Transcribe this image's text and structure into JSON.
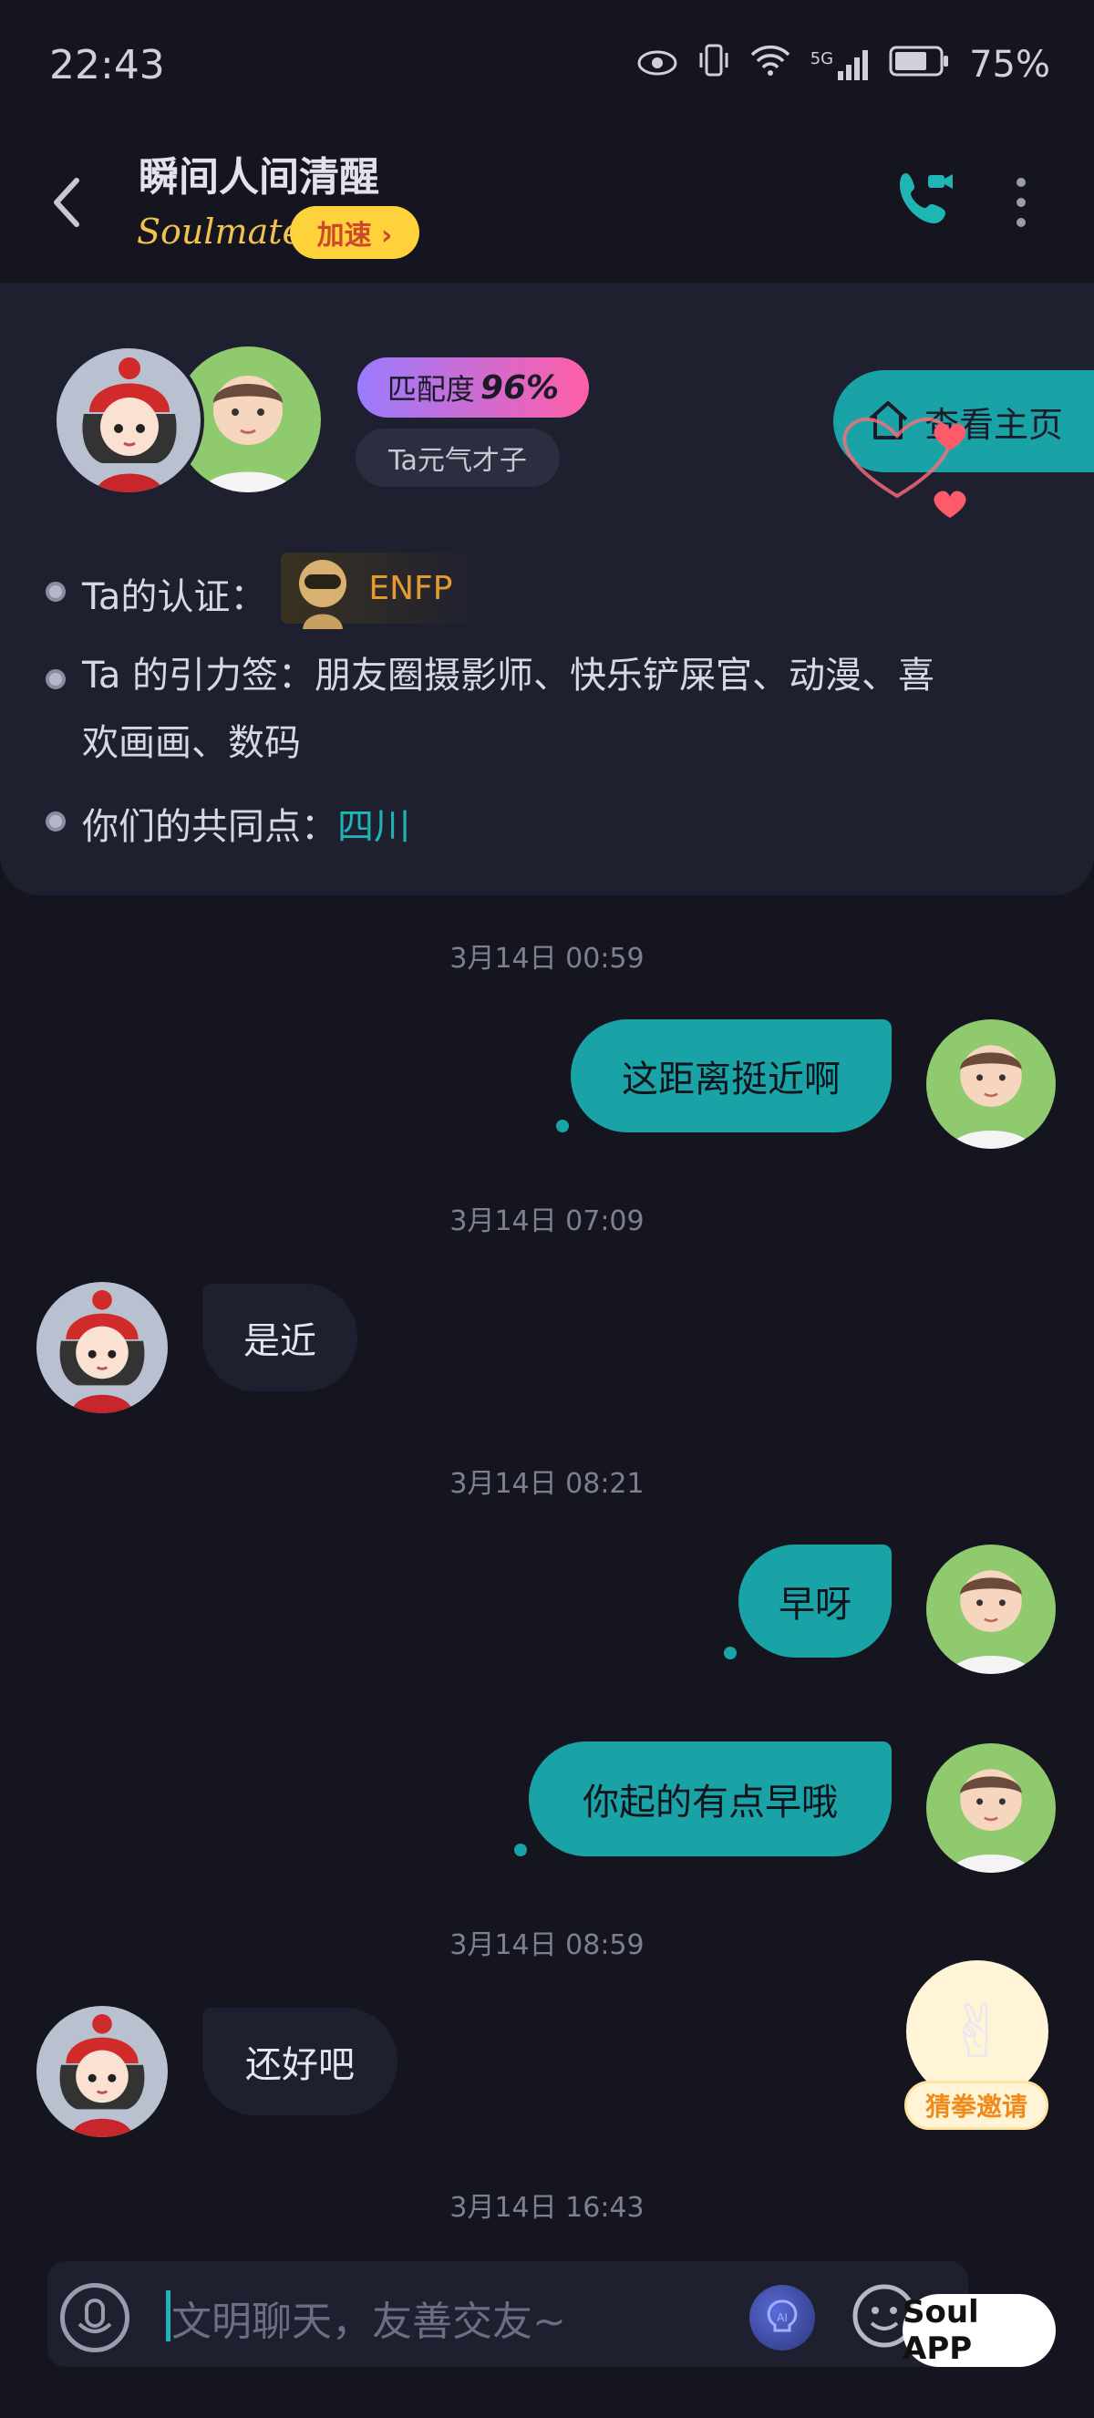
{
  "status_bar": {
    "time": "22:43",
    "network": "5G",
    "battery": "75%"
  },
  "header": {
    "title": "瞬间人间清醒",
    "soulmate_label": "Soulmate",
    "boost_label": "加速 ›"
  },
  "profile": {
    "match_label": "匹配度",
    "match_value": "96%",
    "tag": "Ta元气才子",
    "homepage_button": "查看主页",
    "cert_label": "Ta的认证：",
    "cert_value": "ENFP",
    "gravity_label": "Ta 的引力签：朋友圈摄影师、快乐铲屎官、动漫、喜",
    "gravity_line2": "欢画画、数码",
    "common_label": "你们的共同点：",
    "common_value": "四川"
  },
  "messages": [
    {
      "time": "3月14日 00:59",
      "side": "right",
      "text": "这距离挺近啊"
    },
    {
      "time": "3月14日 07:09",
      "side": "left",
      "text": "是近"
    },
    {
      "time": "3月14日 08:21",
      "side": "right",
      "text": "早呀"
    },
    {
      "time": "",
      "side": "right",
      "text": "你起的有点早哦"
    },
    {
      "time": "3月14日 08:59",
      "side": "left",
      "text": "还好吧"
    },
    {
      "time": "3月14日 16:43",
      "side": "",
      "text": ""
    }
  ],
  "game_invite": {
    "label": "猜拳邀请"
  },
  "input": {
    "placeholder": "文明聊天，友善交友~"
  },
  "watermark": "Soul APP",
  "colors": {
    "accent": "#1aa3a6",
    "background": "#14151f",
    "card": "#1e2030",
    "boost": "#ffd23c"
  }
}
